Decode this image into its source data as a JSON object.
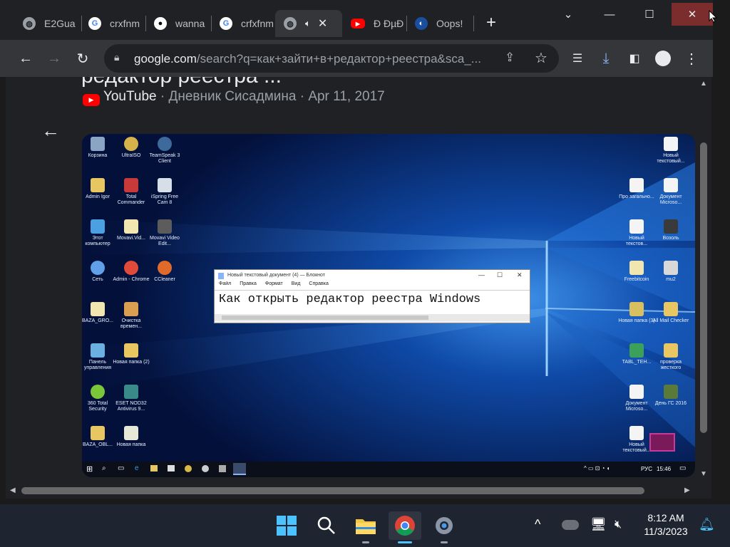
{
  "tabs": [
    {
      "label": "E2Gua",
      "favicon": "globe-icon"
    },
    {
      "label": "crxfnm",
      "favicon": "google-icon"
    },
    {
      "label": "wanna",
      "favicon": "github-icon"
    },
    {
      "label": "crfxfnm",
      "favicon": "google-icon"
    },
    {
      "label": "",
      "favicon": "globe-icon",
      "audio": "speaker-icon"
    },
    {
      "label": "Ð ÐµÐ",
      "favicon": "youtube-icon"
    },
    {
      "label": "Oops!",
      "favicon": "oops-icon"
    }
  ],
  "toolbar": {
    "url_host": "google.com",
    "url_path": "/search?q=как+зайти+в+редактор+реестра&sca_..."
  },
  "result": {
    "title_partial": "редактор реестра ...",
    "source": "YouTube",
    "meta": " · Дневник Сисадмина · Apr 11, 2017"
  },
  "video": {
    "notepad_title": "Новый текстовый документ (4) — Блокнот",
    "notepad_menu": [
      "Файл",
      "Правка",
      "Формат",
      "Вид",
      "Справка"
    ],
    "notepad_text": "Как открыть редактор реестра Windows",
    "desktop_left": [
      "Корзина",
      "UltraISO",
      "TeamSpeak 3 Client",
      "Admin Igor",
      "Total Commander",
      "iSpring Free Cam 8",
      "Этот компьютер",
      "Movavi.Vid...",
      "Movavi Video Edit...",
      "Сеть",
      "Admin - Chrome",
      "CCleaner",
      "BAZA_GRO...",
      "Очистка времен...",
      "Панель управления",
      "Новая папка (2)",
      "360 Total Security",
      "ESET NOD32 Antivirus 9...",
      "BAZA_OBL...",
      "Новая папка"
    ],
    "desktop_right": [
      "Новый текстовый...",
      "Про загально...",
      "Документ Microso...",
      "Новый текстов...",
      "Возоль",
      "Freebitcoin",
      "mu2",
      "Новая папка (3)",
      "All Mail Checker",
      "TABL_TEH...",
      "проверка жесткого",
      "Документ Microso...",
      "День ГС 2016",
      "Новый текстовый..."
    ],
    "tray_lang": "РУС",
    "tray_time": "15:46"
  },
  "taskbar": {
    "time": "8:12 AM",
    "date": "11/3/2023"
  },
  "colors": {
    "tab_bg": "#202124",
    "toolbar_bg": "#35363a",
    "accent": "#8ab4f8",
    "close_hover": "#7b2d2d"
  }
}
